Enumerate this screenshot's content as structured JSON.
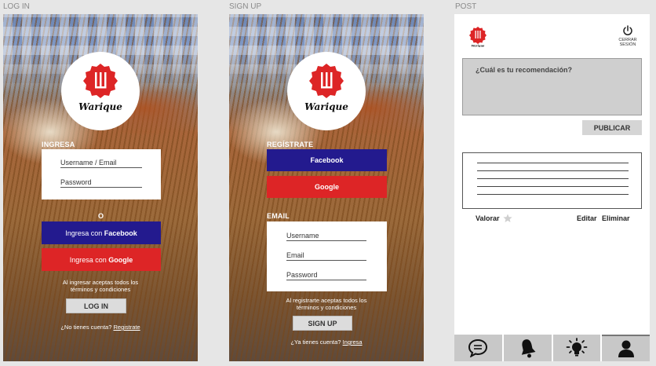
{
  "frames": {
    "login": "LOG IN",
    "signup": "SIGN UP",
    "post": "POST"
  },
  "brand": {
    "name": "Warique",
    "red": "#dd2526",
    "blue": "#231a8e"
  },
  "login": {
    "section": "INGRESA",
    "username_placeholder": "Username / Email",
    "password_placeholder": "Password",
    "or": "O",
    "fb_prefix": "Ingresa con ",
    "fb_brand": "Facebook",
    "g_prefix": "Ingresa con ",
    "g_brand": "Google",
    "terms": "Al ingresar aceptas todos los términos y condiciones",
    "button": "LOG IN",
    "no_account": "¿No tienes cuenta?",
    "register_link": "Registrate"
  },
  "signup": {
    "section": "REGÍSTRATE",
    "facebook": "Facebook",
    "google": "Google",
    "email_section": "EMAIL",
    "username_placeholder": "Username",
    "email_placeholder": "Email",
    "password_placeholder": "Password",
    "terms": "Al registrarte aceptas todos los términos y condiciones",
    "button": "SIGN UP",
    "have_account": "¿Ya tienes cuenta?",
    "login_link": "Ingresa"
  },
  "post": {
    "logout": "CERRAR SESIÓN",
    "placeholder": "¿Cuál es tu recomendación?",
    "publish": "PUBLICAR",
    "rate": "Valorar",
    "edit": "Editar",
    "delete": "Eliminar",
    "tabs": [
      "chat-icon",
      "bell-icon",
      "lightbulb-icon",
      "user-icon"
    ]
  }
}
